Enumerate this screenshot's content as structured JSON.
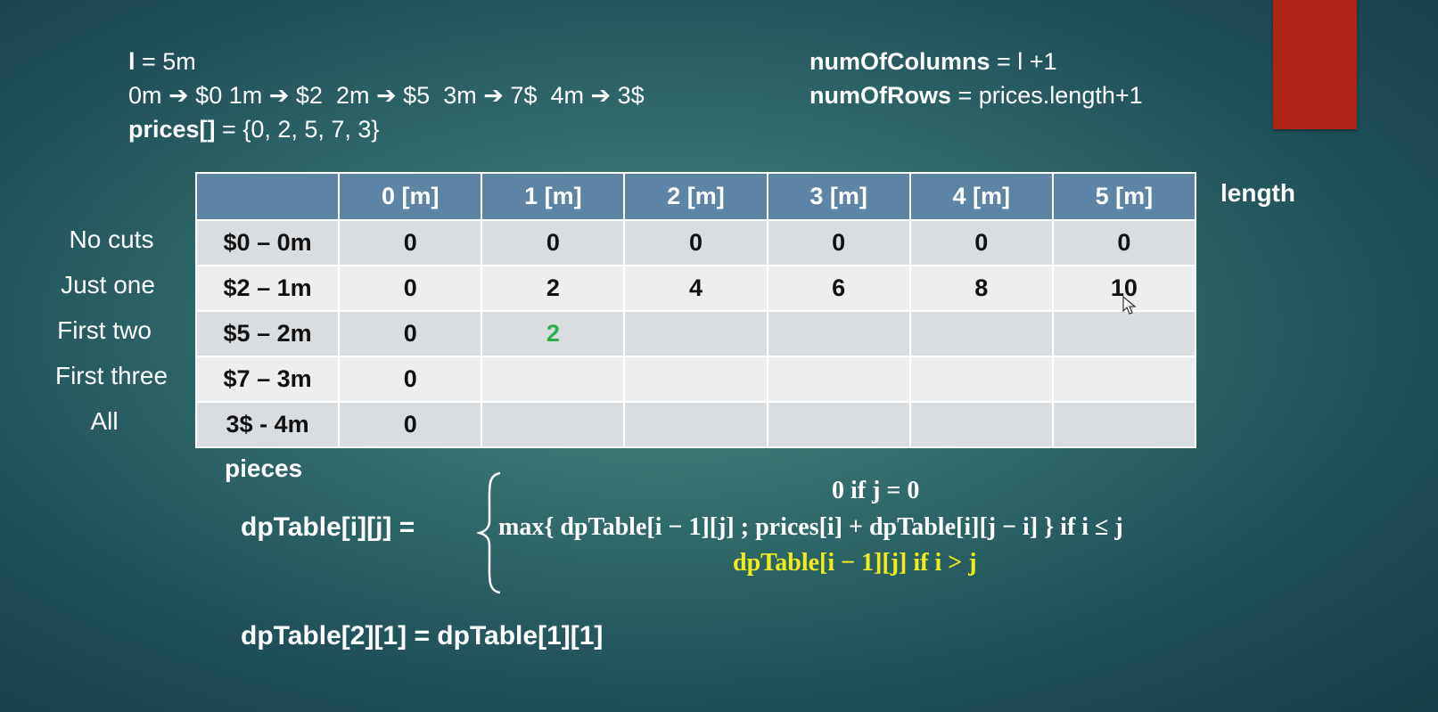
{
  "header": {
    "l_label": "l",
    "l_value": " = 5m",
    "mapping": [
      {
        "len": "0m",
        "price": "$0"
      },
      {
        "len": "1m",
        "price": "$2"
      },
      {
        "len": "2m",
        "price": "$5"
      },
      {
        "len": "3m",
        "price": "7$"
      },
      {
        "len": "4m",
        "price": "3$"
      }
    ],
    "arrow": "➔",
    "prices_label": "prices[]",
    "prices_value": " = {0, 2, 5, 7, 3}",
    "cols_label": "numOfColumns",
    "cols_value": " = l +1",
    "rows_label": "numOfRows",
    "rows_value": " = prices.length+1"
  },
  "table": {
    "columns": [
      "",
      "0 [m]",
      "1 [m]",
      "2 [m]",
      "3 [m]",
      "4 [m]",
      "5 [m]"
    ],
    "rows": [
      {
        "label": "No cuts",
        "piece": "$0 – 0m",
        "values": [
          "0",
          "0",
          "0",
          "0",
          "0",
          "0"
        ]
      },
      {
        "label": "Just one",
        "piece": "$2 – 1m",
        "values": [
          "0",
          "2",
          "4",
          "6",
          "8",
          "10"
        ]
      },
      {
        "label": "First two",
        "piece": "$5 – 2m",
        "values": [
          "0",
          "2",
          "",
          "",
          "",
          ""
        ]
      },
      {
        "label": "First three",
        "piece": "$7 – 3m",
        "values": [
          "0",
          "",
          "",
          "",
          "",
          ""
        ]
      },
      {
        "label": "All",
        "piece": "3$ - 4m",
        "values": [
          "0",
          "",
          "",
          "",
          "",
          ""
        ]
      }
    ],
    "highlight_color": "#2eae4b",
    "length_label": "length",
    "pieces_label": "pieces"
  },
  "formula": {
    "lhs": "dpTable[i][j] =",
    "case1": "0 if j = 0",
    "case2": "max{ dpTable[i − 1][j] ; prices[i] + dpTable[i][j − i] } if i  ≤ j",
    "case3": "dpTable[i − 1][j] if  i > j",
    "case3_color": "#f2ec1c"
  },
  "example": "dpTable[2][1] = dpTable[1][1]",
  "colors": {
    "header_cell": "#5d84a4",
    "accent_block": "#b02418"
  }
}
